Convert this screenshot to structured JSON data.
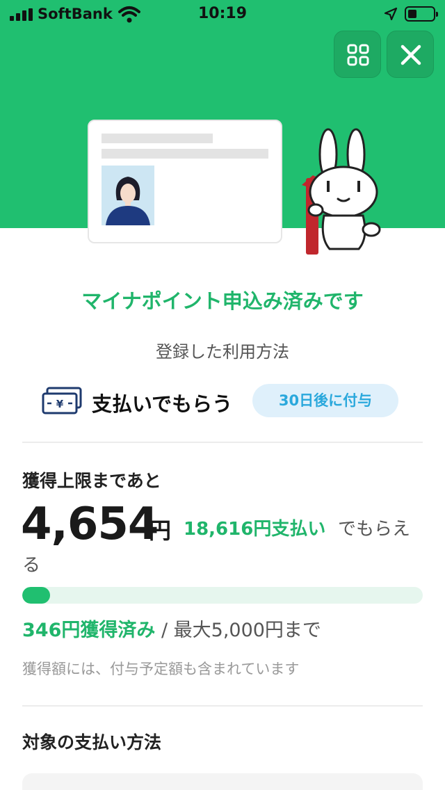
{
  "status_bar": {
    "carrier": "SoftBank",
    "time": "10:19"
  },
  "header": {
    "apps_icon": "grid-icon",
    "close_icon": "close-icon"
  },
  "title": "マイナポイント申込み済みです",
  "method": {
    "heading": "登録した利用方法",
    "icon": "money-icon",
    "name": "支払いでもらう",
    "badge": "30日後に付与"
  },
  "limit": {
    "label": "獲得上限まであと",
    "remaining": "4,654",
    "unit": "円",
    "spend_text": "18,616円支払い",
    "get_text": "でもらえ",
    "get_text_2": "る",
    "progress_fraction": 0.0692,
    "earned": "346円獲得済み",
    "max_text": " / 最大5,000円まで",
    "note": "獲得額には、付与予定額も含まれています"
  },
  "target": {
    "title": "対象の支払い方法"
  },
  "colors": {
    "brand_green": "#20bf70",
    "badge_blue": "#2aa8dc"
  }
}
